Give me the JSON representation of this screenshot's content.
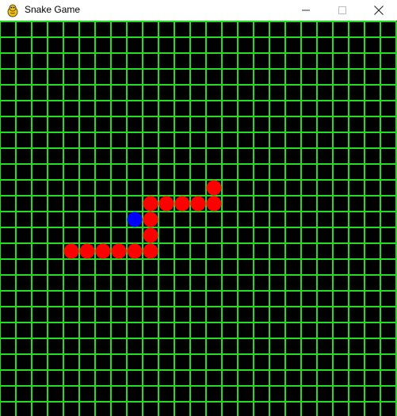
{
  "window": {
    "title": "Snake Game",
    "icon": "pygame-snake-icon",
    "controls": [
      "minimize",
      "maximize",
      "close"
    ]
  },
  "game": {
    "grid_columns": 25,
    "grid_rows": 25,
    "colors": {
      "background": "#000000",
      "grid_lines": "#22dd22",
      "snake": "#ff0000",
      "food": "#0000ff"
    },
    "snake": [
      [
        13,
        10
      ],
      [
        13,
        11
      ],
      [
        12,
        11
      ],
      [
        11,
        11
      ],
      [
        10,
        11
      ],
      [
        9,
        11
      ],
      [
        9,
        12
      ],
      [
        9,
        13
      ],
      [
        9,
        14
      ],
      [
        8,
        14
      ],
      [
        7,
        14
      ],
      [
        6,
        14
      ],
      [
        5,
        14
      ],
      [
        4,
        14
      ]
    ],
    "food": [
      8,
      12
    ]
  }
}
